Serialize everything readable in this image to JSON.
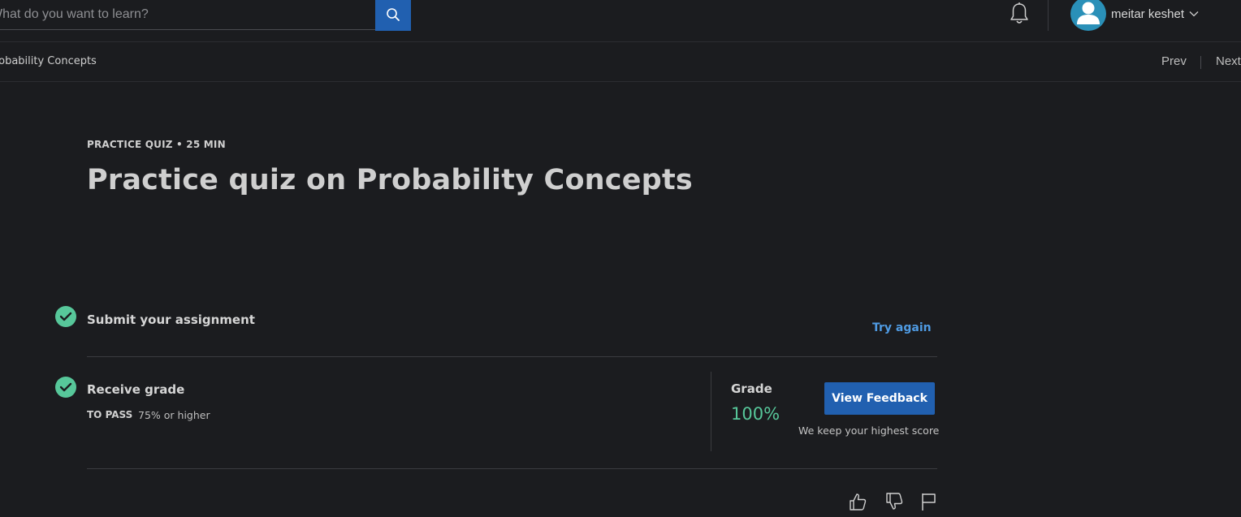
{
  "search": {
    "placeholder": "What do you want to learn?",
    "value": ""
  },
  "header": {
    "user_name": "meitar keshet",
    "icons": [
      "search-icon",
      "bell-icon",
      "user-avatar-icon",
      "chevron-down-icon"
    ]
  },
  "breadcrumb": {
    "label": "Practice quiz on Probability Concepts"
  },
  "navigation": {
    "prev_label": "Prev",
    "next_label": "Next"
  },
  "quiz": {
    "kicker": "PRACTICE QUIZ • 25 MIN",
    "title": "Practice quiz on Probability Concepts"
  },
  "steps": {
    "submit": {
      "title": "Submit your assignment",
      "action_label": "Try again"
    },
    "receive": {
      "title": "Receive grade",
      "pass_label": "TO PASS",
      "pass_value": "75% or higher"
    }
  },
  "grade": {
    "label": "Grade",
    "value": "100%",
    "button_label": "View Feedback",
    "note": "We keep your highest score"
  },
  "feedback_icons": [
    "thumbs-up-icon",
    "thumbs-down-icon",
    "flag-icon"
  ],
  "colors": {
    "background": "#1b1c1f",
    "accent_blue": "#2160b0",
    "link_blue": "#4f9be3",
    "success_green": "#57c79a",
    "avatar": "#2a90b8"
  }
}
